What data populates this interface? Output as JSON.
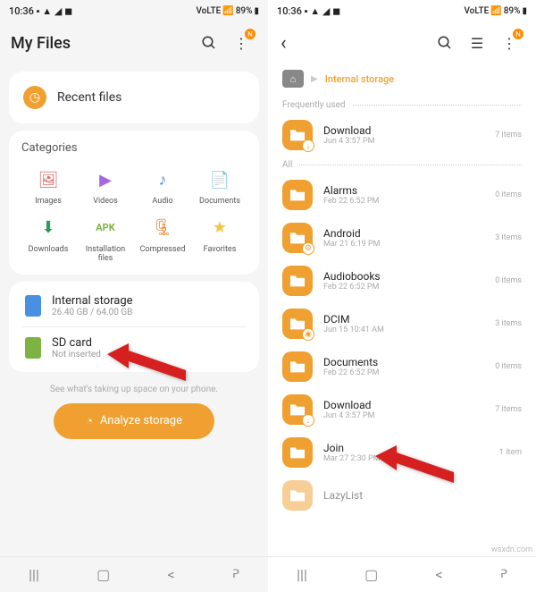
{
  "status": {
    "time": "10:36",
    "battery": "89%",
    "netLabel": "VoLTE"
  },
  "left": {
    "title": "My Files",
    "recent": "Recent files",
    "categoriesTitle": "Categories",
    "cats": {
      "c0": "Images",
      "c1": "Videos",
      "c2": "Audio",
      "c3": "Documents",
      "c4": "Downloads",
      "c5": "Installation files",
      "c6": "Compressed",
      "c7": "Favorites"
    },
    "storage": {
      "internal": {
        "title": "Internal storage",
        "sub": "26.40 GB / 64.00 GB"
      },
      "sd": {
        "title": "SD card",
        "sub": "Not inserted"
      }
    },
    "hint": "See what's taking up space on your phone.",
    "analyze": "Analyze storage"
  },
  "right": {
    "breadcrumb": "Internal storage",
    "freq": "Frequently used",
    "all": "All",
    "folders": {
      "f0": {
        "name": "Download",
        "date": "Jun 4 3:57 PM",
        "count": "7 items"
      },
      "f1": {
        "name": "Alarms",
        "date": "Feb 22 6:52 PM",
        "count": "0 items"
      },
      "f2": {
        "name": "Android",
        "date": "Mar 21 6:19 PM",
        "count": "3 items"
      },
      "f3": {
        "name": "Audiobooks",
        "date": "Feb 22 6:52 PM",
        "count": "0 items"
      },
      "f4": {
        "name": "DCIM",
        "date": "Jun 15 10:41 AM",
        "count": "3 items"
      },
      "f5": {
        "name": "Documents",
        "date": "Feb 22 6:52 PM",
        "count": "0 items"
      },
      "f6": {
        "name": "Download",
        "date": "Jun 4 3:57 PM",
        "count": "7 items"
      },
      "f7": {
        "name": "Join",
        "date": "Mar 27 2:30 PM",
        "count": "1 item"
      },
      "f8": {
        "name": "LazyList",
        "date": "",
        "count": ""
      }
    }
  },
  "watermark": "wsxdn.com",
  "badge": "N"
}
